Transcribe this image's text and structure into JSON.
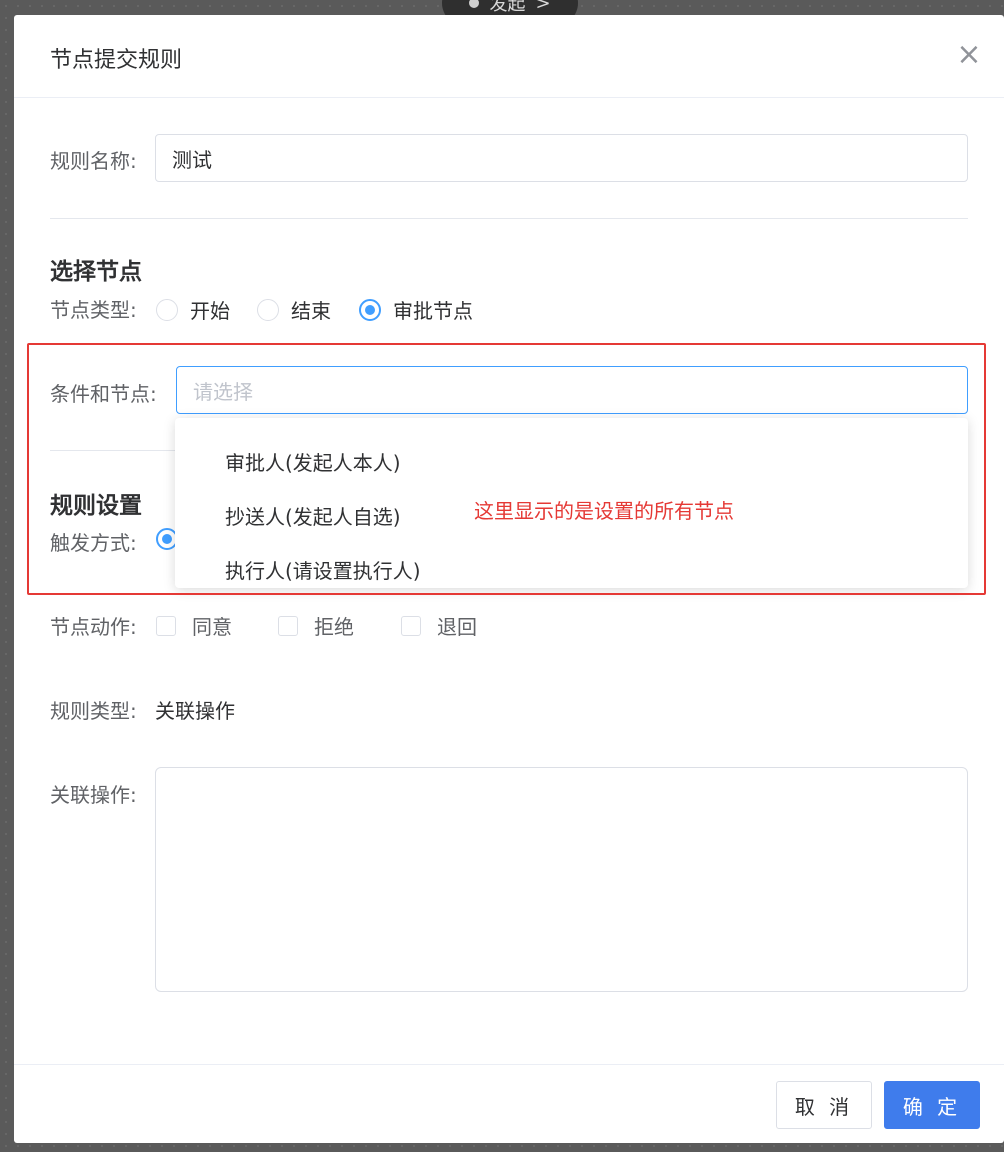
{
  "background_node": {
    "label": "发起",
    "chevron": ">"
  },
  "dialog": {
    "title": "节点提交规则",
    "close_icon": "×"
  },
  "rule_name": {
    "label": "规则名称:",
    "value": "测试"
  },
  "select_node_section": {
    "title": "选择节点",
    "node_type_label": "节点类型:",
    "node_types": [
      {
        "label": "开始",
        "checked": false
      },
      {
        "label": "结束",
        "checked": false
      },
      {
        "label": "审批节点",
        "checked": true
      }
    ],
    "condition_label": "条件和节点:",
    "condition_placeholder": "请选择",
    "dropdown_options": [
      "审批人(发起人本人)",
      "抄送人(发起人自选)",
      "执行人(请设置执行人)"
    ]
  },
  "rule_settings_section": {
    "title": "规则设置",
    "trigger_label": "触发方式:",
    "actions_label": "节点动作:",
    "actions": [
      {
        "label": "同意",
        "checked": false
      },
      {
        "label": "拒绝",
        "checked": false
      },
      {
        "label": "退回",
        "checked": false
      }
    ],
    "rule_type_label": "规则类型:",
    "rule_type_value": "关联操作",
    "related_ops_label": "关联操作:",
    "related_ops_value": ""
  },
  "footer": {
    "cancel_label": "取 消",
    "confirm_label": "确 定"
  },
  "annotation": {
    "text": "这里显示的是设置的所有节点",
    "color": "#e53935"
  },
  "colors": {
    "accent": "#3f7cec",
    "radio_checked": "#409eff",
    "border": "#dcdfe6"
  }
}
